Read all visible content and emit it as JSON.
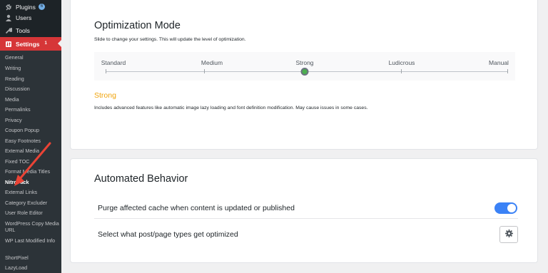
{
  "sidebar": {
    "top_items": [
      {
        "label": "Plugins",
        "icon": "plugin-icon",
        "badge": "6"
      },
      {
        "label": "Users",
        "icon": "users-icon"
      },
      {
        "label": "Tools",
        "icon": "wrench-icon"
      },
      {
        "label": "Settings",
        "icon": "settings-icon",
        "badge": "1"
      }
    ],
    "sub_items": [
      "General",
      "Writing",
      "Reading",
      "Discussion",
      "Media",
      "Permalinks",
      "Privacy",
      "Coupon Popup",
      "Easy Footnotes",
      "External Media",
      "Fixed TOC",
      "Format Media Titles",
      "NitroPack",
      "External Links",
      "Category Excluder",
      "User Role Editor",
      "WordPress Copy Media URL",
      "WP Last Modified Info",
      "ShortPixel",
      "LazyLoad"
    ]
  },
  "optimization": {
    "title": "Optimization Mode",
    "description": "Slide to change your settings. This will update the level of optimization.",
    "stops": [
      "Standard",
      "Medium",
      "Strong",
      "Ludicrous",
      "Manual"
    ],
    "selected_index": 2,
    "mode_name": "Strong",
    "mode_description": "Includes advanced features like automatic image lazy loading and font definition modification. May cause issues in some cases.",
    "accent_color": "#f0a30a"
  },
  "automated": {
    "title": "Automated Behavior",
    "purge_label": "Purge affected cache when content is updated or published",
    "purge_enabled": true,
    "types_label": "Select what post/page types get optimized"
  }
}
